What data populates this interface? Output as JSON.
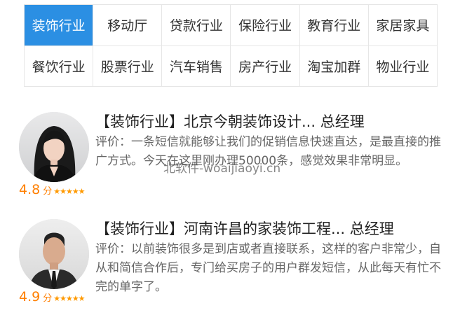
{
  "tabs": [
    {
      "label": "装饰行业",
      "active": true
    },
    {
      "label": "移动厅"
    },
    {
      "label": "贷款行业"
    },
    {
      "label": "保险行业"
    },
    {
      "label": "教育行业"
    },
    {
      "label": "家居家具"
    },
    {
      "label": "餐饮行业"
    },
    {
      "label": "股票行业"
    },
    {
      "label": "汽车销售"
    },
    {
      "label": "房产行业"
    },
    {
      "label": "淘宝加群"
    },
    {
      "label": "物业行业"
    }
  ],
  "reviews": [
    {
      "title": "【装饰行业】北京今朝装饰设计...  总经理",
      "comment": "评价：一条短信就能够让我们的促销信息快速直达，是最直接的推广方式。今天在这里刚办理50000条，感觉效果非常明显。",
      "score": "4.8",
      "score_unit": "分",
      "stars": "★★★★★",
      "avatar_icon": "woman-portrait-icon"
    },
    {
      "title": "【装饰行业】河南许昌的家装饰工程...  总经理",
      "comment": "评价：以前装饰很多是到店或者直接联系，这样的客户非常少，自从和简信合作后，专门给买房子的用户群发短信，从此每天有忙不完的单字了。",
      "score": "4.9",
      "score_unit": "分",
      "stars": "★★★★★",
      "avatar_icon": "man-portrait-icon"
    }
  ],
  "watermark": "北软件-woaijiaoyi.cn",
  "colors": {
    "accent": "#2b8fe3",
    "score": "#ff7f00",
    "stars": "#ff9900"
  }
}
